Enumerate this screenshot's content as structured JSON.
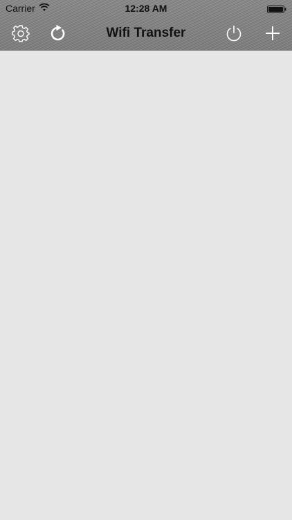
{
  "status_bar": {
    "carrier": "Carrier",
    "time": "12:28 AM",
    "wifi_icon": "wifi-icon",
    "battery_icon": "battery-icon"
  },
  "nav_bar": {
    "title": "Wifi Transfer",
    "left_icons": [
      "gear-icon",
      "refresh-icon"
    ],
    "right_icons": [
      "power-icon",
      "plus-icon"
    ]
  },
  "colors": {
    "nav_background": "#868686",
    "content_background": "#e6e6e6",
    "icon_color": "#ffffff",
    "text_color": "#111111"
  }
}
